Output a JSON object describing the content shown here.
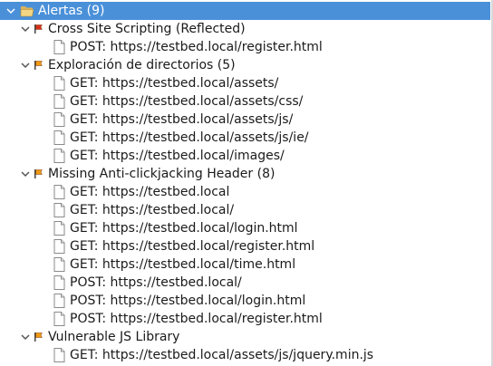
{
  "root": {
    "label": "Alertas (9)",
    "icon": "folder-open-icon"
  },
  "alerts": [
    {
      "label": "Cross Site Scripting (Reflected)",
      "risk": "high",
      "flag_color": "#d9301c",
      "items": [
        "POST: https://testbed.local/register.html"
      ]
    },
    {
      "label": "Exploración de directorios (5)",
      "risk": "medium",
      "flag_color": "#f09a12",
      "items": [
        "GET: https://testbed.local/assets/",
        "GET: https://testbed.local/assets/css/",
        "GET: https://testbed.local/assets/js/",
        "GET: https://testbed.local/assets/js/ie/",
        "GET: https://testbed.local/images/"
      ]
    },
    {
      "label": "Missing Anti-clickjacking Header (8)",
      "risk": "medium",
      "flag_color": "#f09a12",
      "items": [
        "GET: https://testbed.local",
        "GET: https://testbed.local/",
        "GET: https://testbed.local/login.html",
        "GET: https://testbed.local/register.html",
        "GET: https://testbed.local/time.html",
        "POST: https://testbed.local/",
        "POST: https://testbed.local/login.html",
        "POST: https://testbed.local/register.html"
      ]
    },
    {
      "label": "Vulnerable JS Library",
      "risk": "medium",
      "flag_color": "#f09a12",
      "items": [
        "GET: https://testbed.local/assets/js/jquery.min.js"
      ]
    }
  ]
}
